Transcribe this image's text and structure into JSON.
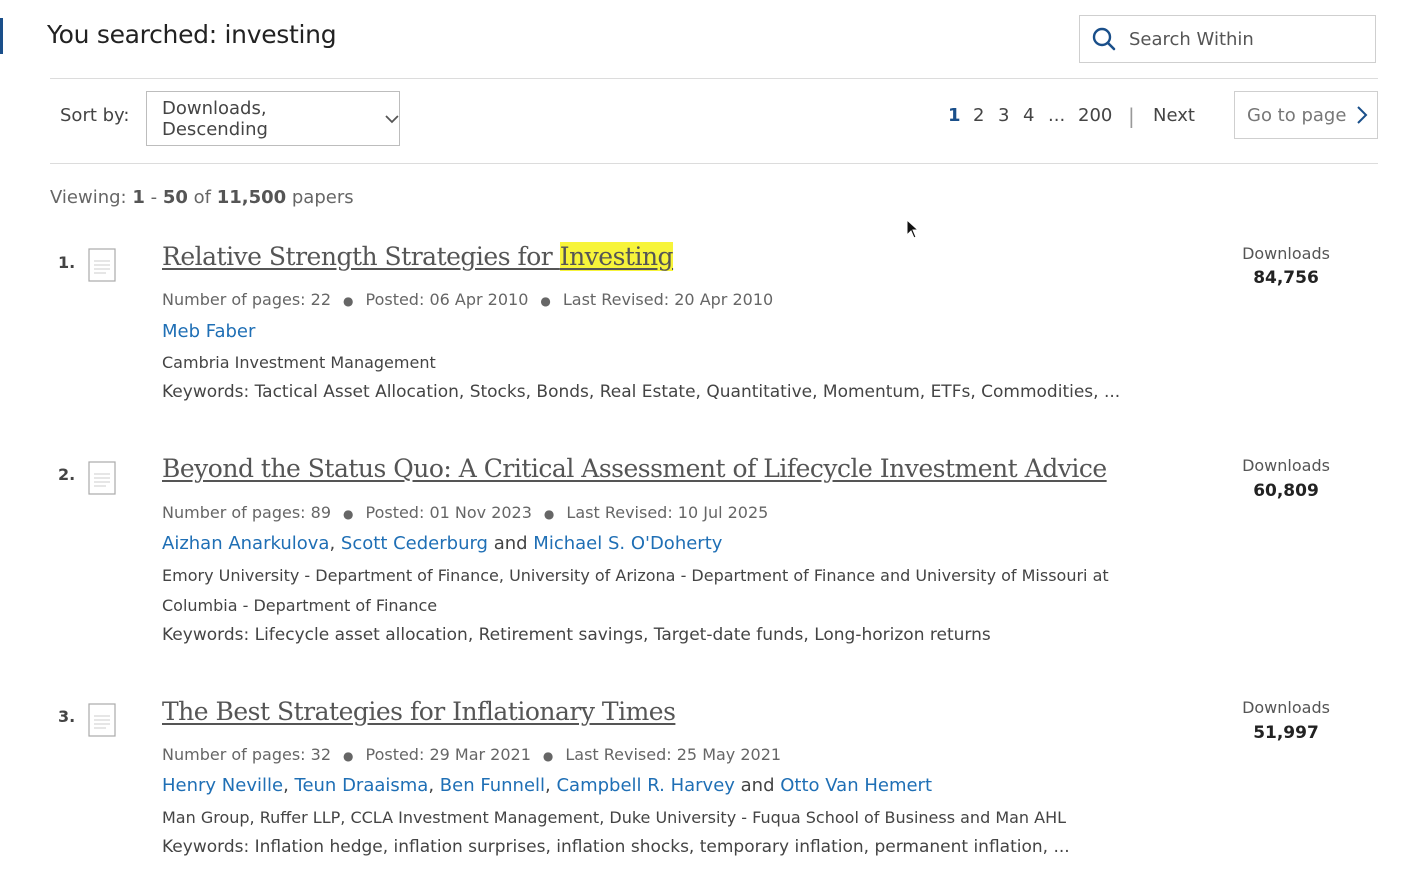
{
  "header": {
    "search_prefix": "You searched: ",
    "search_term": "investing",
    "search_within_placeholder": "Search Within"
  },
  "toolbar": {
    "sort_label": "Sort by:",
    "sort_value": "Downloads, Descending",
    "pagination": {
      "pages": [
        "1",
        "2",
        "3",
        "4",
        "...",
        "200"
      ],
      "current": "1",
      "next_label": "Next",
      "goto_label": "Go to page"
    }
  },
  "viewing": {
    "prefix": "Viewing: ",
    "start": "1",
    "dash": " - ",
    "end": "50",
    "of": " of ",
    "total": "11,500",
    "suffix": " papers"
  },
  "results": [
    {
      "number": "1.",
      "title_before": "Relative Strength Strategies for ",
      "title_highlight": "Investing",
      "title_after": "",
      "pages": "Number of pages: 22",
      "posted": "Posted: 06 Apr 2010",
      "revised": "Last Revised: 20 Apr 2010",
      "authors": [
        "Meb Faber"
      ],
      "affiliation": "Cambria Investment Management",
      "keywords": "Keywords: Tactical Asset Allocation, Stocks, Bonds, Real Estate, Quantitative, Momentum, ETFs, Commodities, ...",
      "downloads_label": "Downloads",
      "downloads": "84,756"
    },
    {
      "number": "2.",
      "title_before": "Beyond the Status Quo: A Critical Assessment of Lifecycle Investment Advice",
      "title_highlight": "",
      "title_after": "",
      "pages": "Number of pages: 89",
      "posted": "Posted: 01 Nov 2023",
      "revised": "Last Revised: 10 Jul 2025",
      "authors": [
        "Aizhan Anarkulova",
        "Scott Cederburg",
        "Michael S. O'Doherty"
      ],
      "affiliation": "Emory University - Department of Finance, University of Arizona - Department of Finance and University of Missouri at Columbia - Department of Finance",
      "keywords": "Keywords: Lifecycle asset allocation, Retirement savings, Target-date funds, Long-horizon returns",
      "downloads_label": "Downloads",
      "downloads": "60,809"
    },
    {
      "number": "3.",
      "title_before": "The Best Strategies for Inflationary Times",
      "title_highlight": "",
      "title_after": "",
      "pages": "Number of pages: 32",
      "posted": "Posted: 29 Mar 2021",
      "revised": "Last Revised: 25 May 2021",
      "authors": [
        "Henry Neville",
        "Teun Draaisma",
        "Ben Funnell",
        "Campbell R. Harvey",
        "Otto Van Hemert"
      ],
      "affiliation": "Man Group, Ruffer LLP, CCLA Investment Management, Duke University - Fuqua School of Business and Man AHL",
      "keywords": "Keywords: Inflation hedge, inflation surprises, inflation shocks, temporary inflation, permanent inflation, ...",
      "downloads_label": "Downloads",
      "downloads": "51,997"
    }
  ],
  "author_separators": {
    "comma": ", ",
    "and": " and "
  }
}
